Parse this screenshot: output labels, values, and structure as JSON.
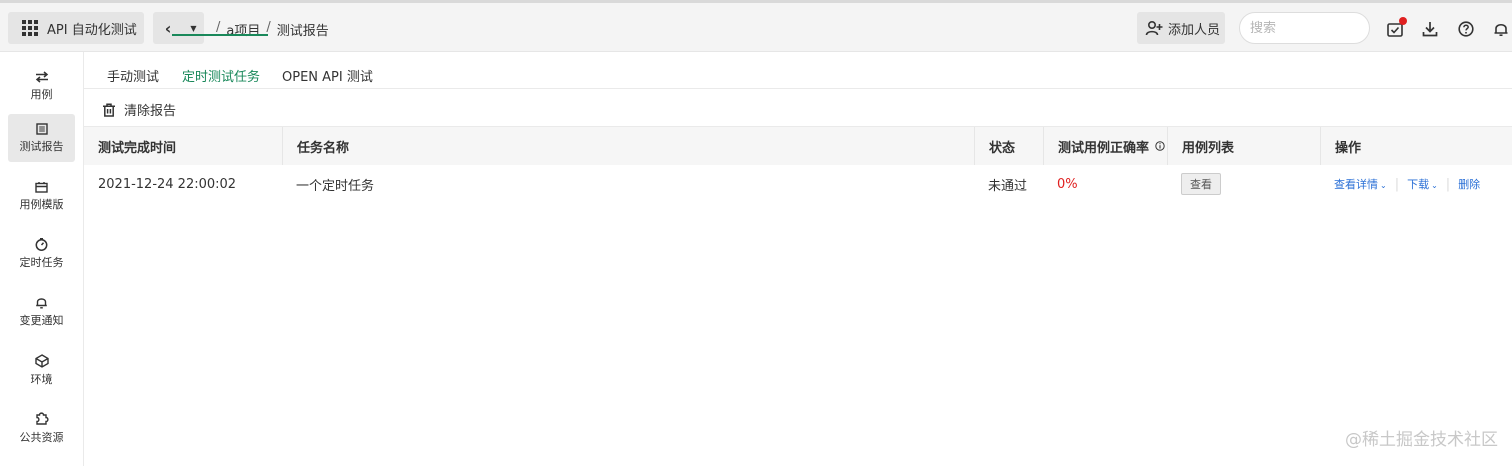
{
  "header": {
    "app_title": "API 自动化测试",
    "breadcrumb": [
      "a项目",
      "测试报告"
    ],
    "add_member_label": "添加人员",
    "search_placeholder": "搜索",
    "icons": [
      "tasks-icon",
      "download-icon",
      "help-icon",
      "bell-icon"
    ],
    "notification_color": "#e02020"
  },
  "sidebar": {
    "items": [
      {
        "label": "用例",
        "icon": "case-icon"
      },
      {
        "label": "测试报告",
        "icon": "report-icon",
        "active": true
      },
      {
        "label": "用例模版",
        "icon": "template-icon"
      },
      {
        "label": "定时任务",
        "icon": "timer-icon"
      },
      {
        "label": "变更通知",
        "icon": "bell-icon"
      },
      {
        "label": "环境",
        "icon": "environment-icon"
      },
      {
        "label": "公共资源",
        "icon": "puzzle-icon"
      }
    ]
  },
  "tabs": [
    {
      "label": "手动测试"
    },
    {
      "label": "定时测试任务",
      "active": true
    },
    {
      "label": "OPEN API 测试"
    }
  ],
  "toolbar": {
    "clear_label": "清除报告"
  },
  "table": {
    "columns": [
      "测试完成时间",
      "任务名称",
      "状态",
      "测试用例正确率",
      "用例列表",
      "操作"
    ],
    "rows": [
      {
        "time": "2021-12-24 22:00:02",
        "name": "一个定时任务",
        "status": "未通过",
        "rate": "0%",
        "list_action": "查看",
        "actions": [
          "查看详情",
          "下载",
          "删除"
        ]
      }
    ]
  },
  "watermark": "@稀土掘金技术社区",
  "colors": {
    "accent": "#19885a",
    "link": "#2a6fd6",
    "danger": "#e02020"
  }
}
